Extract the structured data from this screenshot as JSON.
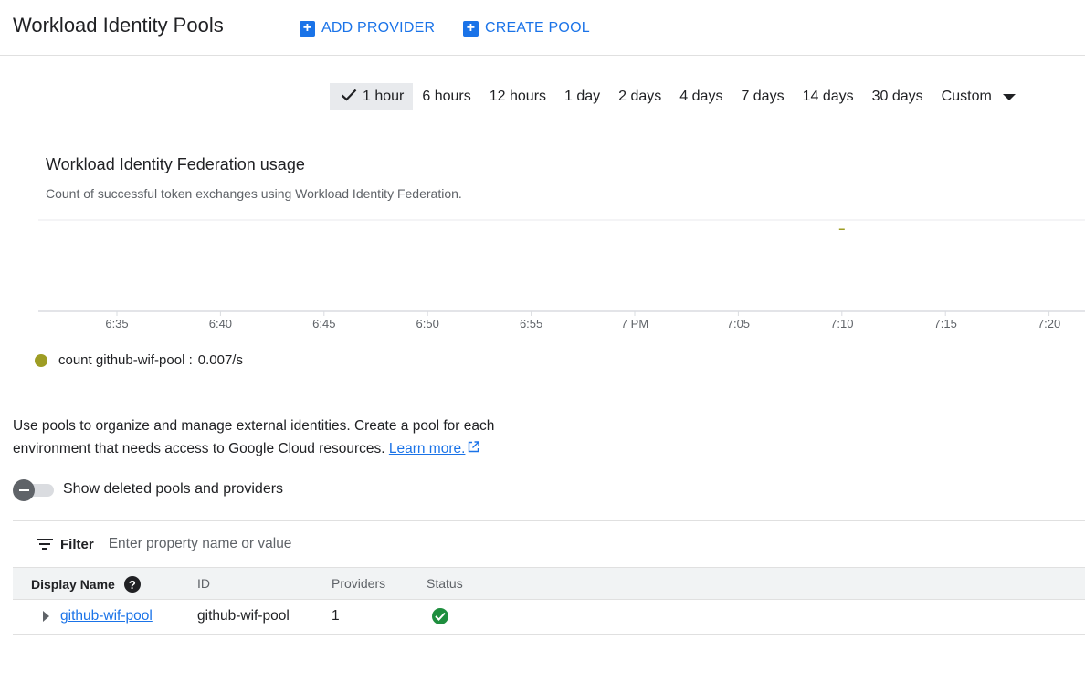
{
  "header": {
    "title": "Workload Identity Pools",
    "add_provider": "ADD PROVIDER",
    "create_pool": "CREATE POOL"
  },
  "time_range": {
    "options": [
      "1 hour",
      "6 hours",
      "12 hours",
      "1 day",
      "2 days",
      "4 days",
      "7 days",
      "14 days",
      "30 days",
      "Custom"
    ],
    "selected": "1 hour"
  },
  "chart": {
    "title": "Workload Identity Federation usage",
    "subtitle": "Count of successful token exchanges using Workload Identity Federation.",
    "legend_label": "count github-wif-pool :",
    "legend_value": "0.007/s"
  },
  "chart_data": {
    "type": "line",
    "title": "Workload Identity Federation usage",
    "x_tick_labels": [
      "6:35",
      "6:40",
      "6:45",
      "6:50",
      "6:55",
      "7 PM",
      "7:05",
      "7:10",
      "7:15",
      "7:20"
    ],
    "series": [
      {
        "name": "count github-wif-pool",
        "color": "#9e9d24",
        "points": [
          {
            "x": "7:10",
            "y": 0.007
          }
        ]
      }
    ],
    "grid": true,
    "legend_position": "bottom-left"
  },
  "description": {
    "text": "Use pools to organize and manage external identities. Create a pool for each environment that needs access to Google Cloud resources.",
    "learn_more": "Learn more."
  },
  "toggle": {
    "label": "Show deleted pools and providers",
    "checked": false
  },
  "filter": {
    "label": "Filter",
    "placeholder": "Enter property name or value"
  },
  "table": {
    "columns": [
      "Display Name",
      "ID",
      "Providers",
      "Status"
    ],
    "rows": [
      {
        "display_name": "github-wif-pool",
        "id": "github-wif-pool",
        "providers": "1",
        "status": "ok"
      }
    ]
  },
  "colors": {
    "accent": "#1a73e8",
    "series": "#9e9d24",
    "status_ok": "#1e8e3e"
  }
}
